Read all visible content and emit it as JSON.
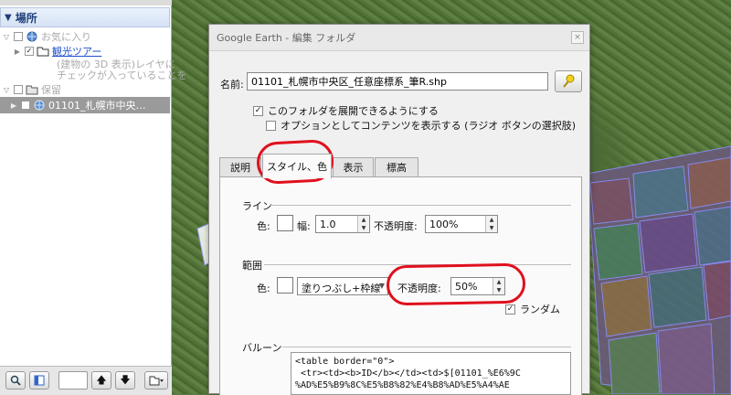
{
  "left_panel": {
    "header": "場所",
    "tree": [
      {
        "label": "お気に入り",
        "style": "greyed"
      },
      {
        "label": "観光ツアー",
        "style": "link"
      },
      {
        "label": "(建物の 3D 表示)レイヤに",
        "style": "greyed"
      },
      {
        "label": "チェックが入っていることを",
        "style": "greyed"
      },
      {
        "label": "保留",
        "style": "greyed"
      },
      {
        "label": "01101_札幌市中央…",
        "style": "selected"
      }
    ]
  },
  "dialog": {
    "title": "Google Earth - 編集 フォルダ",
    "close_glyph": "×",
    "name_label": "名前:",
    "name_value": "01101_札幌市中央区_任意座標系_筆R.shp",
    "expand_checkbox": {
      "label": "このフォルダを展開できるようにする",
      "checked": true,
      "mark": "✓"
    },
    "radio_checkbox": {
      "label": "オプションとしてコンテンツを表示する (ラジオ ボタンの選択肢)",
      "checked": false
    },
    "tabs": [
      {
        "label": "説明",
        "active": false
      },
      {
        "label": "スタイル、色",
        "active": true
      },
      {
        "label": "表示",
        "active": false
      },
      {
        "label": "標高",
        "active": false
      }
    ],
    "line_section": {
      "title": "ライン",
      "color_label": "色:",
      "width_label": "幅:",
      "width_value": "1.0",
      "opacity_label": "不透明度:",
      "opacity_value": "100%"
    },
    "area_section": {
      "title": "範囲",
      "color_label": "色:",
      "fill_value": "塗りつぶし+枠線",
      "opacity_label": "不透明度:",
      "opacity_value": "50%",
      "random_label": "ランダム",
      "random_checked": true,
      "random_mark": "✓"
    },
    "balloon_section": {
      "title": "バルーン",
      "text": "<table border=\"0\">\n <tr><td><b>ID</b></td><td>$[01101_%E6%9C\n%AD%E5%B9%8C%E5%B8%82%E4%B8%AD%E5%A4%AE"
    }
  },
  "colors": {
    "annotation": "#e0101e",
    "header_text": "#1f3f7a",
    "link": "#1f4fcc"
  }
}
